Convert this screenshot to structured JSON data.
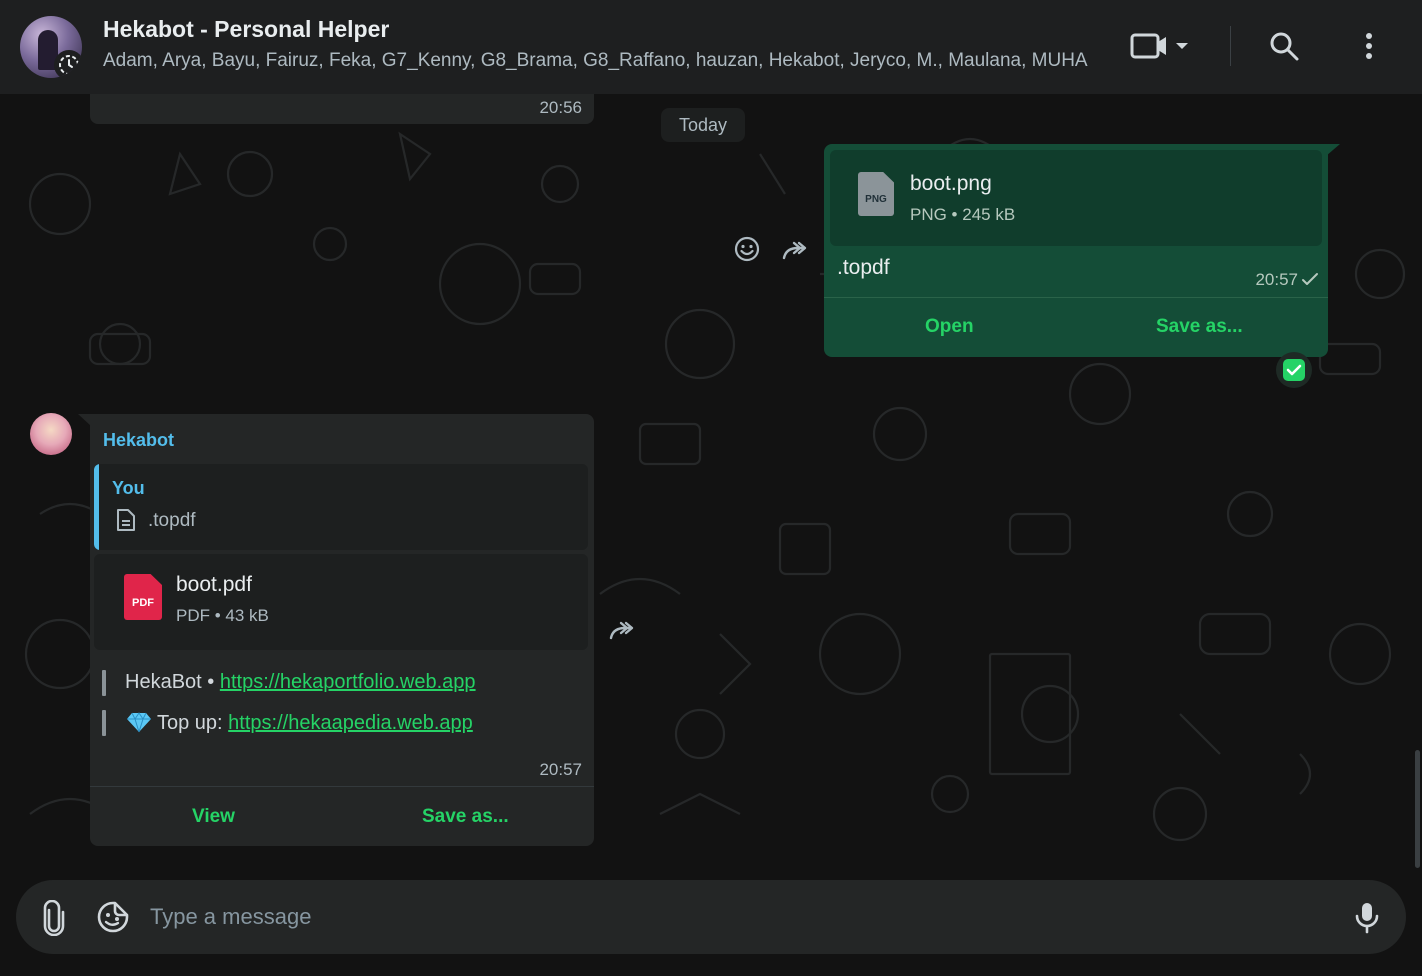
{
  "header": {
    "title": "Hekabot - Personal Helper",
    "members": "Adam, Arya, Bayu, Fairuz, Feka, G7_Kenny, G8_Brama, G8_Raffano, hauzan, Hekabot, Jeryco, M., Maulana, MUHA..."
  },
  "chat": {
    "prev_time": "20:56",
    "date_chip": "Today",
    "outgoing": {
      "file_icon_label": "PNG",
      "file_name": "boot.png",
      "file_meta": "PNG • 245 kB",
      "caption": ".topdf",
      "time": "20:57",
      "open_label": "Open",
      "save_label": "Save as..."
    },
    "incoming": {
      "sender": "Hekabot",
      "quote_author": "You",
      "quote_text": ".topdf",
      "file_icon_label": "PDF",
      "file_name": "boot.pdf",
      "file_meta": "PDF • 43 kB",
      "line1_prefix": "HekaBot • ",
      "line1_link": "https://hekaportfolio.web.app",
      "line2_prefix": "Top up: ",
      "line2_link": "https://hekaapedia.web.app",
      "time": "20:57",
      "view_label": "View",
      "save_label": "Save as..."
    }
  },
  "composer": {
    "placeholder": "Type a message"
  },
  "colors": {
    "accent": "#25d366",
    "sender": "#53bdeb",
    "outgoing_bubble": "#144d37",
    "incoming_bubble": "#242626"
  },
  "icons": [
    "video-call-icon",
    "chevron-down-icon",
    "search-icon",
    "menu-icon",
    "emoji-icon",
    "forward-icon",
    "check-icon",
    "selected-check-icon",
    "document-icon",
    "gem-icon",
    "attach-icon",
    "sticker-icon",
    "mic-icon"
  ]
}
